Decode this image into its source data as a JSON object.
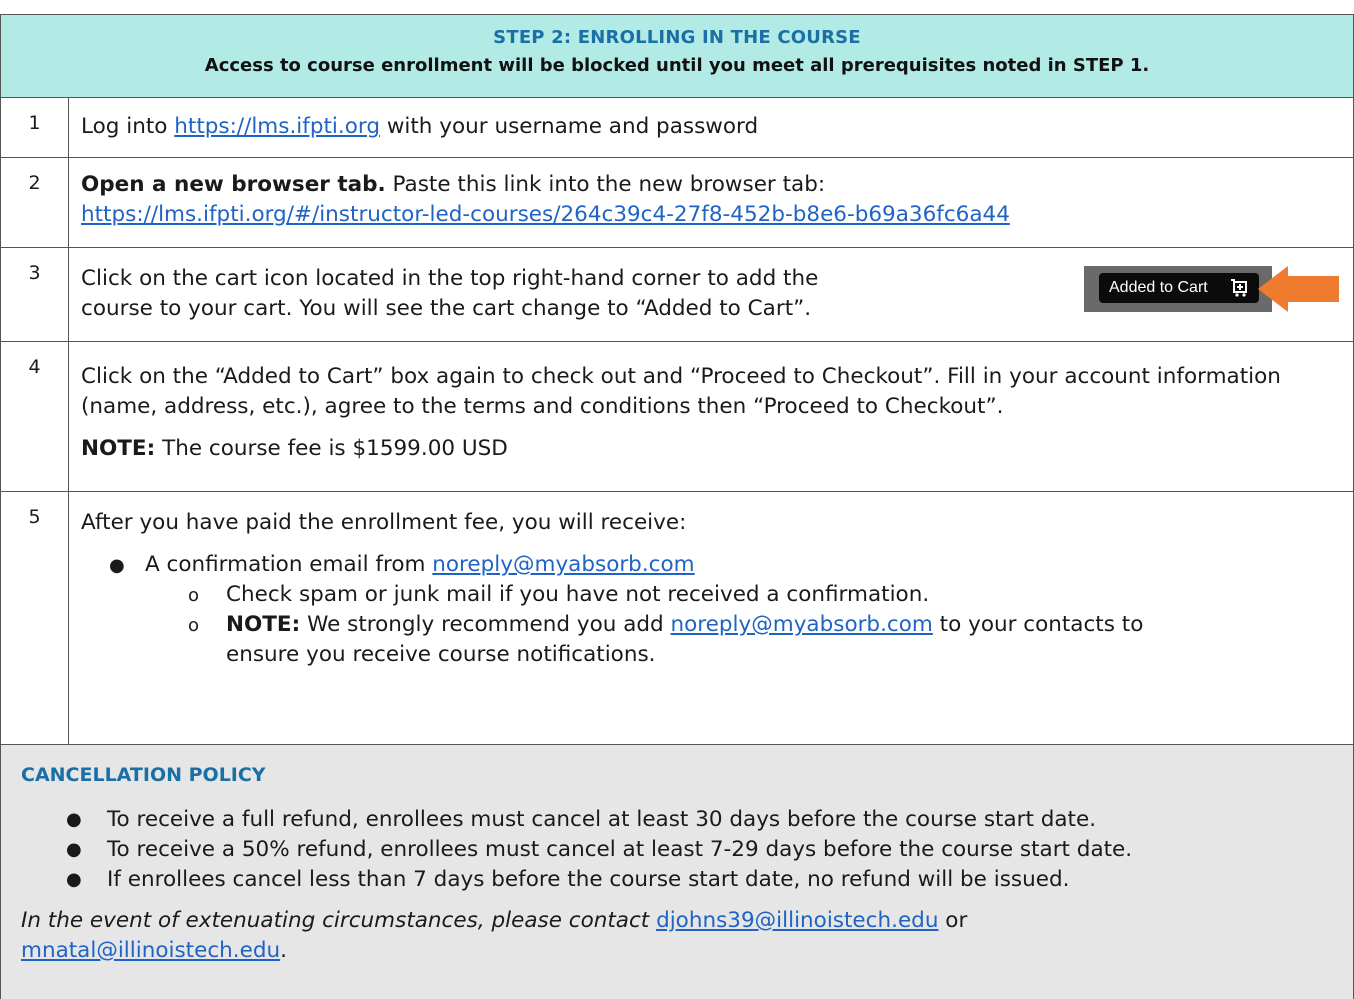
{
  "header": {
    "title": "STEP 2: ENROLLING IN THE COURSE",
    "subtitle": "Access to course enrollment will be blocked until you meet all prerequisites noted in STEP 1."
  },
  "steps": [
    {
      "number": "1",
      "text_before": "Log into ",
      "link": "https://lms.ifpti.org",
      "text_after": " with your username and password"
    },
    {
      "number": "2",
      "bold": "Open a new browser tab.",
      "text": " Paste this link into the new browser tab:",
      "link": "https://lms.ifpti.org/#/instructor-led-courses/264c39c4-27f8-452b-b8e6-b69a36fc6a44"
    },
    {
      "number": "3",
      "line1": "Click on the cart icon located in the top right-hand corner to add the",
      "line2": "course to your cart. You will see the cart change to “Added to Cart”.",
      "cart_button_label": "Added to Cart",
      "cart_icon": "cart-icon",
      "arrow_color": "#ef7b2f"
    },
    {
      "number": "4",
      "text": "Click on the “Added to Cart” box again to check out and “Proceed to Checkout”. Fill in your account information (name, address, etc.), agree to the terms and conditions then “Proceed to Checkout”.",
      "note_label": "NOTE:",
      "note_text": " The course fee is $1599.00 USD"
    },
    {
      "number": "5",
      "intro": "After you have paid the enrollment fee, you will receive:",
      "bullet_text": "A confirmation email from ",
      "bullet_link": "noreply@myabsorb.com",
      "sub1": "Check spam or junk mail if you have not received a confirmation.",
      "sub2_label": "NOTE:",
      "sub2_text_before": " We strongly recommend you add ",
      "sub2_link": "noreply@myabsorb.com",
      "sub2_text_after": " to your contacts to",
      "sub2_line2": "ensure you receive course notifications."
    }
  ],
  "cancellation": {
    "title": "CANCELLATION POLICY",
    "items": [
      "To receive a full refund, enrollees must cancel at least 30 days before the course start date.",
      "To receive a 50% refund, enrollees must cancel at least 7-29 days before the course start date.",
      "If enrollees cancel less than 7 days before the course start date, no refund will be issued."
    ],
    "closing_italic": "In the event of extenuating circumstances, please contact ",
    "email1": "djohns39@illinoistech.edu",
    "or": " or ",
    "email2": "mnatal@illinoistech.edu",
    "end": "."
  },
  "colors": {
    "header_bg": "#b2ebe6",
    "heading_blue": "#1a6fa5",
    "link_blue": "#1f63c4",
    "cancel_bg": "#e6e6e6"
  }
}
